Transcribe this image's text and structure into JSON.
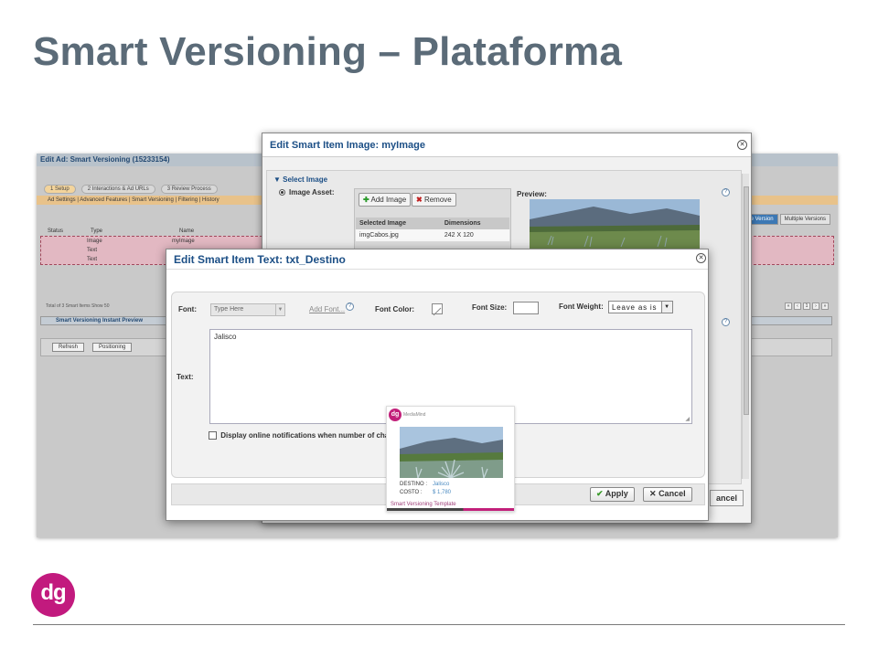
{
  "slide": {
    "title": "Smart Versioning – Plataforma",
    "brand": "dg"
  },
  "colors": {
    "title": "#5b6b78",
    "brand": "#c21a7e",
    "dialog_title": "#1c4f86"
  },
  "bg_screen": {
    "title": "Edit Ad: Smart Versioning (15233154)",
    "tabs": [
      "1  Setup",
      "2  Interactions & Ad URLs",
      "3  Review Process"
    ],
    "subnav": "Ad Settings  |  Advanced Features  |  Smart Versioning  |  Filtering  |  History",
    "table_headers": [
      "Status",
      "Type",
      "Name"
    ],
    "rows": [
      {
        "type": "Image",
        "name": "myImage"
      },
      {
        "type": "Text",
        "name": ""
      },
      {
        "type": "Text",
        "name": ""
      }
    ],
    "right_tabs": [
      "ple Version",
      "Multiple Versions"
    ],
    "footer_text": "Total of 3 Smart Items      Show 50",
    "preview_bar": "Smart Versioning Instant Preview",
    "buttons": [
      "Refresh",
      "Positioning"
    ]
  },
  "image_dialog": {
    "title": "Edit Smart Item Image: myImage",
    "section": "▼  Select Image",
    "asset_label": "Image Asset:",
    "add_image": "Add Image",
    "remove": "Remove",
    "preview_label": "Preview:",
    "table_headers": [
      "Selected Image",
      "Dimensions"
    ],
    "table_rows": [
      [
        "imgCabos.jpg",
        "242 X 120"
      ]
    ],
    "cancel_fragment": "ancel"
  },
  "text_dialog": {
    "title": "Edit Smart Item Text: txt_Destino",
    "font_label": "Font:",
    "font_value": "Type Here",
    "add_font": "Add Font...",
    "font_color_label": "Font Color:",
    "font_size_label": "Font Size:",
    "font_weight_label": "Font Weight:",
    "font_weight_value": "Leave as is",
    "text_label": "Text:",
    "text_value": "Jalisco",
    "notification_label": "Display online notifications when number of chara",
    "apply": "Apply",
    "cancel": "Cancel"
  },
  "ad_preview": {
    "brand": "MediaMind",
    "logo": "dg",
    "destino_label": "DESTINO :",
    "destino_value": "Jalisco",
    "costo_label": "COSTO :",
    "costo_value": "$ 1,780",
    "template": "Smart Versioning Template"
  }
}
